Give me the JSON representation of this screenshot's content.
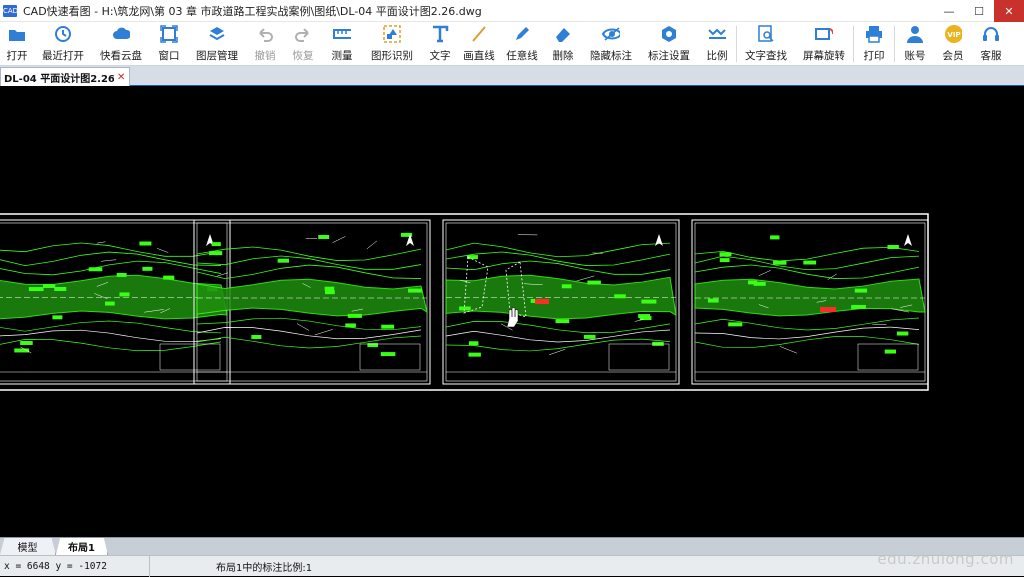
{
  "app": {
    "logo_text": "CAD",
    "title": "CAD快速看图 - H:\\筑龙网\\第 03 章 市政道路工程实战案例\\图纸\\DL-04 平面设计图2.26.dwg"
  },
  "window_controls": {
    "minimize": "—",
    "maximize": "☐",
    "close": "✕"
  },
  "toolbar": {
    "items": [
      {
        "label": "打开",
        "icon": "folder-icon"
      },
      {
        "label": "最近打开",
        "icon": "recent-icon"
      },
      {
        "label": "快看云盘",
        "icon": "cloud-icon"
      },
      {
        "label": "窗口",
        "icon": "window-icon"
      },
      {
        "label": "图层管理",
        "icon": "layers-icon"
      },
      {
        "label": "撤销",
        "icon": "undo-icon",
        "disabled": true
      },
      {
        "label": "恢复",
        "icon": "redo-icon",
        "disabled": true
      },
      {
        "label": "测量",
        "icon": "measure-icon"
      },
      {
        "label": "图形识别",
        "icon": "shape-recognize-icon"
      },
      {
        "label": "文字",
        "icon": "text-icon"
      },
      {
        "label": "画直线",
        "icon": "line-icon"
      },
      {
        "label": "任意线",
        "icon": "pen-icon"
      },
      {
        "label": "删除",
        "icon": "eraser-icon"
      },
      {
        "label": "隐藏标注",
        "icon": "eye-icon"
      },
      {
        "label": "标注设置",
        "icon": "annotation-settings-icon"
      },
      {
        "label": "比例",
        "icon": "scale-icon"
      },
      {
        "label": "文字查找",
        "icon": "text-search-icon"
      },
      {
        "label": "屏幕旋转",
        "icon": "rotate-screen-icon"
      },
      {
        "label": "打印",
        "icon": "printer-icon"
      },
      {
        "label": "账号",
        "icon": "user-icon"
      },
      {
        "label": "会员",
        "icon": "vip-icon",
        "badge": "VIP"
      },
      {
        "label": "客服",
        "icon": "headset-icon"
      }
    ]
  },
  "doc_tab": {
    "label": "DL-04 平面设计图2.26",
    "close": "✕"
  },
  "layout_tabs": {
    "model": "模型",
    "layout": "布局1"
  },
  "status": {
    "coords": "x = 6648 y = -1072",
    "scale_text": "布局1中的标注比例:1"
  },
  "watermark": "edu.zhulong.com",
  "colors": {
    "canvas_bg": "#000000",
    "cad_green": "#39ff14",
    "cad_white": "#ffffff",
    "cad_red": "#ff2a2a",
    "accent_blue": "#2f6bd3"
  }
}
